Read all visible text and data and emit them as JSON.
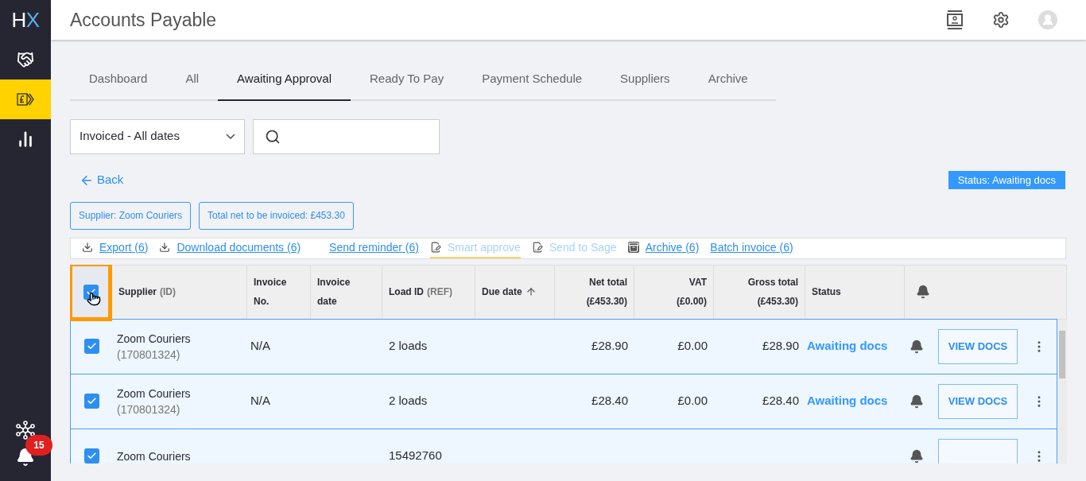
{
  "sidebar": {
    "logo": {
      "h": "H",
      "x": "X"
    },
    "items": [
      {
        "kind": "handshake",
        "selected": false
      },
      {
        "kind": "invoice",
        "selected": true
      },
      {
        "kind": "chart",
        "selected": false
      }
    ],
    "notifications": {
      "count": "15"
    }
  },
  "header": {
    "title": "Accounts Payable"
  },
  "tabs": [
    {
      "label": "Dashboard",
      "selected": false
    },
    {
      "label": "All",
      "selected": false
    },
    {
      "label": "Awaiting Approval",
      "selected": true
    },
    {
      "label": "Ready To Pay",
      "selected": false
    },
    {
      "label": "Payment Schedule",
      "selected": false
    },
    {
      "label": "Suppliers",
      "selected": false
    },
    {
      "label": "Archive",
      "selected": false
    }
  ],
  "filters": {
    "date_select": "Invoiced - All dates"
  },
  "back_link": "Back",
  "status_badge": "Status: Awaiting docs",
  "chips": [
    "Supplier: Zoom Couriers",
    "Total net to be invoiced: £453.30"
  ],
  "actions": [
    {
      "label": "Export (6)",
      "kind": "download",
      "disabled": false,
      "highlighted": false
    },
    {
      "label": "Download documents (6)",
      "kind": "download",
      "disabled": false,
      "highlighted": false
    },
    {
      "label": "Send reminder (6)",
      "kind": "plain",
      "disabled": false,
      "highlighted": false
    },
    {
      "label": "Smart approve",
      "kind": "note",
      "disabled": true,
      "highlighted": true
    },
    {
      "label": "Send to Sage",
      "kind": "note",
      "disabled": true,
      "highlighted": false
    },
    {
      "label": "Archive (6)",
      "kind": "archive",
      "disabled": false,
      "highlighted": false
    },
    {
      "label": "Batch invoice (6)",
      "kind": "plain",
      "disabled": false,
      "highlighted": false
    }
  ],
  "table": {
    "select_all": {
      "checked": true
    },
    "columns": [
      {
        "label": "Supplier",
        "sub": "(ID)",
        "sorted": false
      },
      {
        "label": "Invoice",
        "sub": "No.",
        "sorted": false
      },
      {
        "label": "Invoice",
        "sub": "date",
        "sorted": false
      },
      {
        "label": "Load ID",
        "sub": "(REF)",
        "sorted": false
      },
      {
        "label": "Due date",
        "sorted": true
      },
      {
        "label": "Net total",
        "sub": "(£453.30)",
        "sorted": false
      },
      {
        "label": "VAT",
        "sub": "(£0.00)",
        "sorted": false
      },
      {
        "label": "Gross total",
        "sub": "(£453.30)",
        "sorted": false
      },
      {
        "label": "Status",
        "sorted": false
      }
    ],
    "rows": [
      {
        "checked": true,
        "supplier": "Zoom Couriers",
        "supplier_id": "(170801324)",
        "invoice_no": "N/A",
        "load_id": "2 loads",
        "net_total": "£28.90",
        "vat": "£0.00",
        "gross_total": "£28.90",
        "status": "Awaiting docs",
        "action": "VIEW DOCS"
      },
      {
        "checked": true,
        "supplier": "Zoom Couriers",
        "supplier_id": "(170801324)",
        "invoice_no": "N/A",
        "load_id": "2 loads",
        "net_total": "£28.40",
        "vat": "£0.00",
        "gross_total": "£28.40",
        "status": "Awaiting docs",
        "action": "VIEW DOCS"
      },
      {
        "checked": true,
        "supplier": "Zoom Couriers",
        "load_id": "15492760"
      }
    ]
  }
}
